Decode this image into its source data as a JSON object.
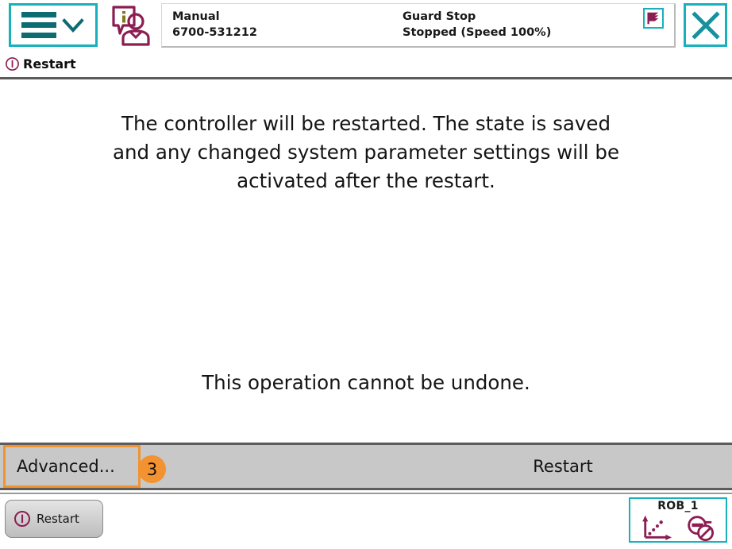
{
  "header": {
    "menu_button": {
      "name": "main-menu",
      "label": ""
    },
    "operator_info_icon": "operator-info-icon",
    "status": {
      "mode_label": "Manual",
      "controller_id": "6700-531212",
      "safety_state": "Guard Stop",
      "motor_state": "Stopped (Speed 100%)",
      "flag_icon": "task-flag-icon"
    },
    "close_button_icon": "close-icon"
  },
  "titlebar": {
    "icon": "restart-warning-icon",
    "title": "Restart"
  },
  "content": {
    "message_main": "The controller will be restarted. The state is saved and any changed system parameter settings will be activated after the restart.",
    "message_sub": "This operation cannot be undone."
  },
  "actionbar": {
    "advanced_label": "Advanced...",
    "badge_number": "3",
    "restart_label": "Restart"
  },
  "taskbar": {
    "task_button_label": "Restart",
    "task_button_icon": "restart-warning-icon",
    "robot": {
      "name": "ROB_1",
      "jog_icon": "coordinate-axes-icon",
      "motors_icon": "motors-off-icon"
    }
  },
  "colors": {
    "accent_teal": "#17b0bd",
    "icon_dark_teal": "#0d6b72",
    "maroon": "#8c1d52",
    "olive": "#7d7b1a",
    "orange": "#f29230",
    "bar_gray": "#c8c8c8",
    "divider_gray": "#5c5c5c"
  }
}
